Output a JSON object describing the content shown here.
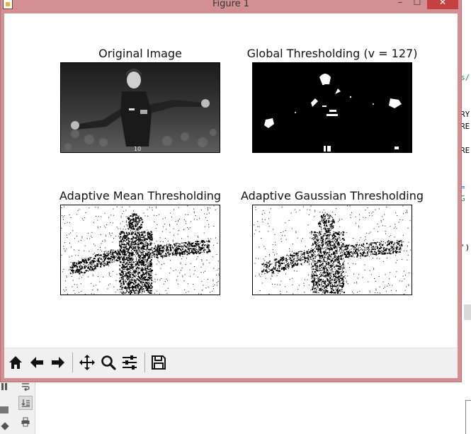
{
  "window": {
    "title": "Figure 1",
    "controls": {
      "minimize": "–",
      "maximize": "☐",
      "close": "✕"
    }
  },
  "figure": {
    "panels": [
      {
        "title": "Original Image",
        "kind": "grayscale"
      },
      {
        "title": "Global Thresholding (v = 127)",
        "kind": "global"
      },
      {
        "title": "Adaptive Mean Thresholding",
        "kind": "adaptive-mean"
      },
      {
        "title": "Adaptive Gaussian Thresholding",
        "kind": "adaptive-gaussian"
      }
    ]
  },
  "toolbar": {
    "buttons": [
      {
        "name": "home-icon",
        "tooltip": "Reset original view"
      },
      {
        "name": "back-icon",
        "tooltip": "Back to previous view"
      },
      {
        "name": "forward-icon",
        "tooltip": "Forward to next view"
      },
      {
        "name": "pan-icon",
        "tooltip": "Pan axes"
      },
      {
        "name": "zoom-icon",
        "tooltip": "Zoom to rectangle"
      },
      {
        "name": "configure-subplots-icon",
        "tooltip": "Configure subplots"
      },
      {
        "name": "save-icon",
        "tooltip": "Save the figure"
      }
    ]
  },
  "background_editor": {
    "code_fragments": [
      "s/",
      "RY",
      "RE",
      "RE",
      "=",
      "G",
      "')"
    ],
    "accent_color": "#1a8a3a"
  },
  "colors": {
    "window_frame": "#d39093",
    "close_button": "#c74040",
    "toolbar_bg": "#f0f0f0"
  }
}
